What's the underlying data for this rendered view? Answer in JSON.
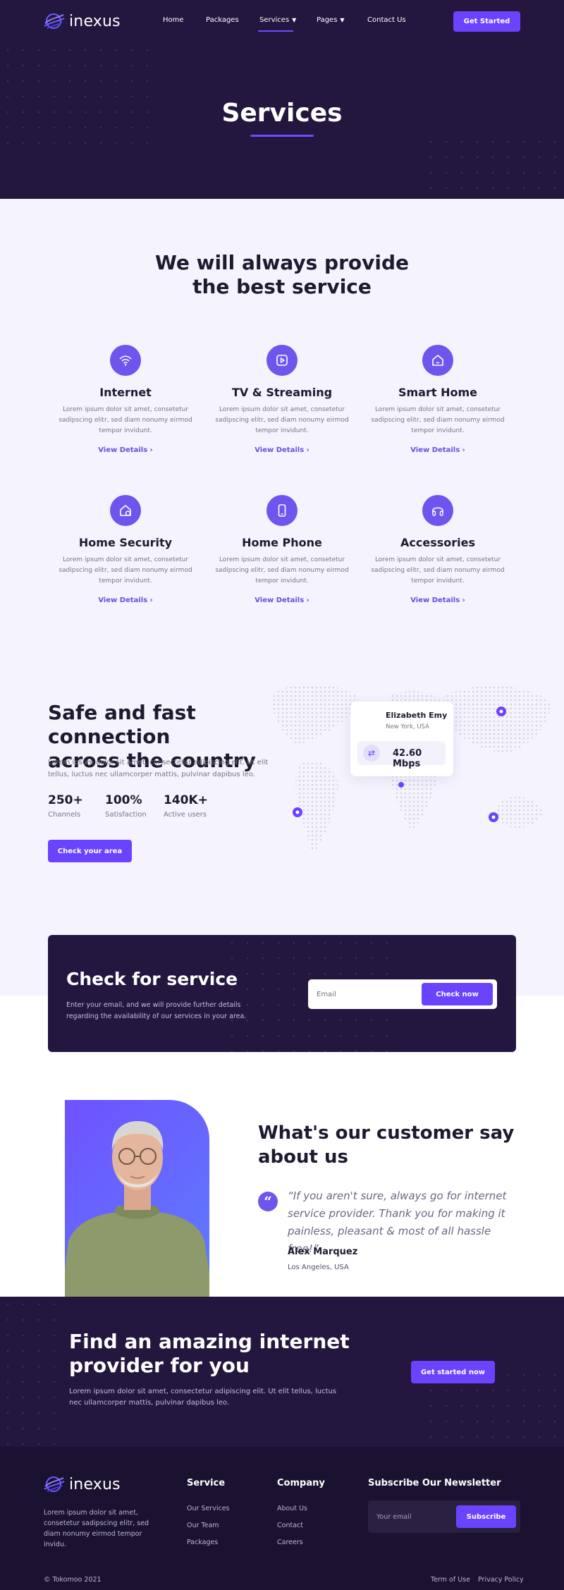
{
  "brand": {
    "name": "inexus"
  },
  "nav": {
    "items": [
      {
        "label": "Home"
      },
      {
        "label": "Packages"
      },
      {
        "label": "Services"
      },
      {
        "label": "Pages"
      },
      {
        "label": "Contact Us"
      }
    ],
    "cta": "Get Started"
  },
  "hero": {
    "title": "Services"
  },
  "services": {
    "heading_line1": "We will always provide",
    "heading_line2": "the best service",
    "cards": [
      {
        "title": "Internet",
        "text": "Lorem ipsum dolor sit amet, consetetur sadipscing elitr, sed diam nonumy eirmod tempor invidunt.",
        "link": "View Details",
        "icon": "wifi-icon"
      },
      {
        "title": "TV & Streaming",
        "text": "Lorem ipsum dolor sit amet, consetetur sadipscing elitr, sed diam nonumy eirmod tempor invidunt.",
        "link": "View Details",
        "icon": "play-icon"
      },
      {
        "title": "Smart Home",
        "text": "Lorem ipsum dolor sit amet, consetetur sadipscing elitr, sed diam nonumy eirmod tempor invidunt.",
        "link": "View Details",
        "icon": "home-icon"
      },
      {
        "title": "Home Security",
        "text": "Lorem ipsum dolor sit amet, consetetur sadipscing elitr, sed diam nonumy eirmod tempor invidunt.",
        "link": "View Details",
        "icon": "home-shield-icon"
      },
      {
        "title": "Home Phone",
        "text": "Lorem ipsum dolor sit amet, consetetur sadipscing elitr, sed diam nonumy eirmod tempor invidunt.",
        "link": "View Details",
        "icon": "phone-icon"
      },
      {
        "title": "Accessories",
        "text": "Lorem ipsum dolor sit amet, consetetur sadipscing elitr, sed diam nonumy eirmod tempor invidunt.",
        "link": "View Details",
        "icon": "headphones-icon"
      }
    ]
  },
  "connection": {
    "title_line1": "Safe and fast connection",
    "title_line2": "across the country",
    "text": "Lorem ipsum dolor sit amet, consectetur adipiscing elit. Ut elit tellus, luctus nec ullamcorper mattis, pulvinar dapibus leo.",
    "stats": [
      {
        "value": "250+",
        "label": "Channels"
      },
      {
        "value": "100%",
        "label": "Satisfaction"
      },
      {
        "value": "140K+",
        "label": "Active users"
      }
    ],
    "button": "Check your area",
    "popup": {
      "name": "Elizabeth Emy",
      "location": "New York, USA",
      "speed": "42.60 Mbps"
    }
  },
  "check_service": {
    "title": "Check for service",
    "text": "Enter your email, and we will provide further details regarding the availability of our services in your area.",
    "placeholder": "Email",
    "button": "Check now"
  },
  "testimonial": {
    "title_line1": "What's our customer say",
    "title_line2": "about us",
    "quote": "“If you aren't sure, always go for internet service provider. Thank you for making it painless, pleasant & most of all hassle free!”",
    "author": "Alex Marquez",
    "location": "Los Angeles, USA"
  },
  "cta": {
    "title_line1": "Find an amazing internet",
    "title_line2": "provider for you",
    "text": "Lorem ipsum dolor sit amet, consectetur adipiscing elit. Ut elit tellus, luctus nec ullamcorper mattis, pulvinar dapibus leo.",
    "button": "Get started now"
  },
  "footer": {
    "about": "Lorem ipsum dolor sit amet, consetetur sadipscing elitr, sed diam nonumy eirmod tempor invidu.",
    "service_heading": "Service",
    "service_links": [
      "Our Services",
      "Our Team",
      "Packages"
    ],
    "company_heading": "Company",
    "company_links": [
      "About Us",
      "Contact",
      "Careers"
    ],
    "newsletter_heading": "Subscribe Our Newsletter",
    "newsletter_placeholder": "Your email",
    "newsletter_button": "Subscribe",
    "copyright": "© Tokomoo 2021",
    "legal_links": [
      "Term of Use",
      "Privacy Policy"
    ]
  },
  "colors": {
    "accent": "#6a43ff",
    "dark": "#23173f",
    "light_bg": "#f5f3fd"
  }
}
